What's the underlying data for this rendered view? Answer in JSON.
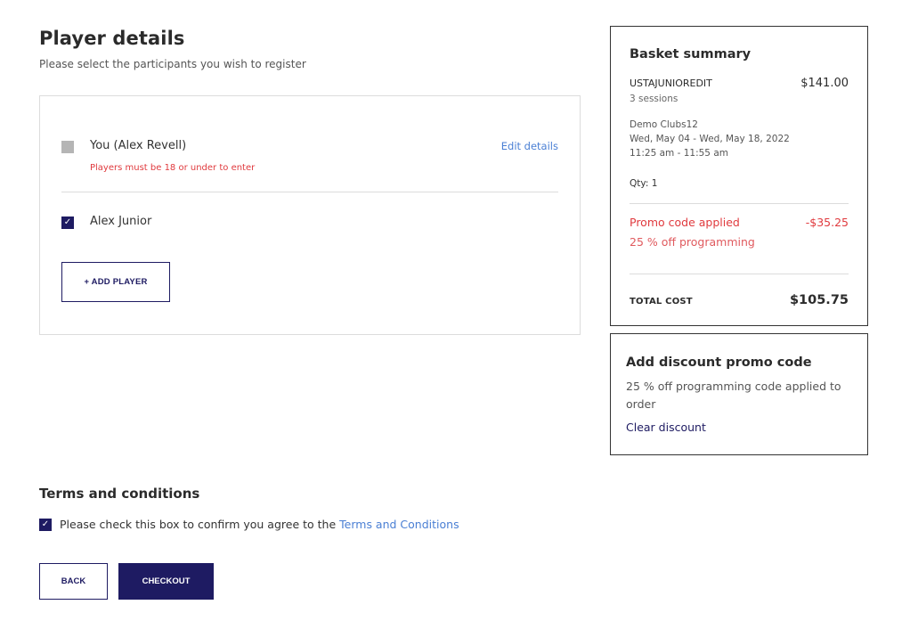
{
  "header": {
    "title": "Player details",
    "subtitle": "Please select the participants you wish to register"
  },
  "players": {
    "items": [
      {
        "name": "You (Alex Revell)",
        "checked": false,
        "disabled": true,
        "error": "Players must be 18 or under to enter",
        "edit_label": "Edit details"
      },
      {
        "name": "Alex Junior",
        "checked": true,
        "disabled": false
      }
    ],
    "add_player_label": "+ ADD PLAYER",
    "checkmark_glyph": "✓"
  },
  "basket": {
    "title": "Basket summary",
    "item": {
      "code": "USTAJUNIOREDIT",
      "price": "$141.00",
      "sessions": "3 sessions",
      "club": "Demo Clubs12",
      "dates": "Wed, May 04 - Wed, May 18, 2022",
      "time": "11:25 am - 11:55 am",
      "qty": "Qty: 1"
    },
    "promo": {
      "label": "Promo code applied",
      "amount": "-$35.25",
      "description": "25 % off programming"
    },
    "total": {
      "label": "TOTAL COST",
      "value": "$105.75"
    }
  },
  "discount": {
    "title": "Add discount promo code",
    "description": "25 % off programming code applied to order",
    "clear_label": "Clear discount"
  },
  "terms": {
    "title": "Terms and conditions",
    "checked": true,
    "text": "Please check this box to confirm you agree to the ",
    "link_label": "Terms and Conditions"
  },
  "actions": {
    "back_label": "BACK",
    "checkout_label": "CHECKOUT"
  },
  "colors": {
    "brand_navy": "#1e1b62",
    "link_blue": "#4a7fd4",
    "error_red": "#e03a3e"
  }
}
